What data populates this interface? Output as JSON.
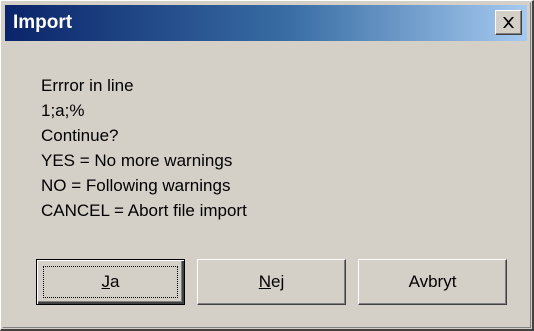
{
  "window": {
    "title": "Import",
    "close_icon": "close-x-icon"
  },
  "message": {
    "lines": [
      "Errror in line",
      "1;a;%",
      "Continue?",
      "YES = No more warnings",
      "NO = Following warnings",
      "CANCEL = Abort file import"
    ]
  },
  "buttons": {
    "yes": {
      "mnemonic": "J",
      "rest": "a"
    },
    "no": {
      "mnemonic": "N",
      "rest": "ej"
    },
    "cancel": {
      "label": "Avbryt"
    }
  },
  "colors": {
    "titlebar_start": "#0a246a",
    "titlebar_end": "#a6caf0",
    "face": "#d4d0c8"
  }
}
